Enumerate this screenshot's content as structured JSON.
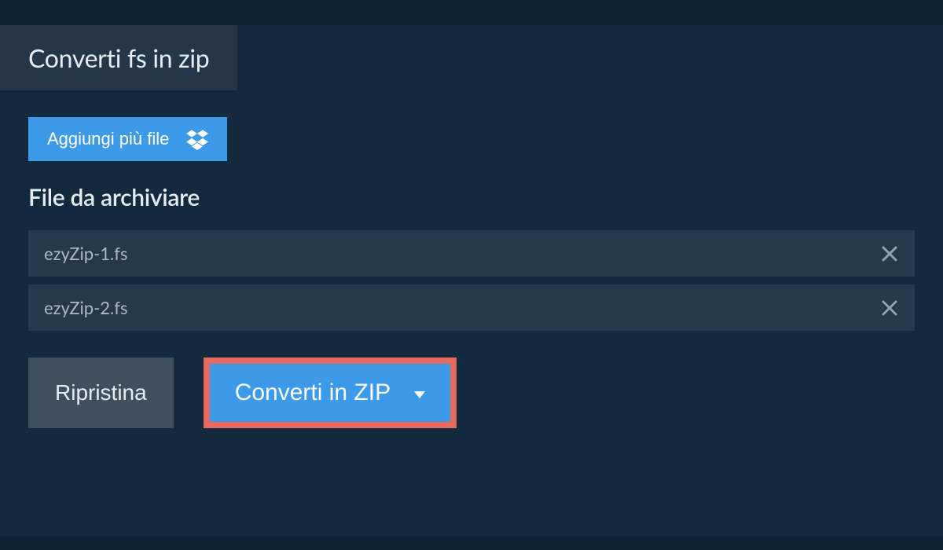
{
  "tab": {
    "title": "Converti fs in zip"
  },
  "add_files": {
    "label": "Aggiungi più file"
  },
  "section": {
    "heading": "File da archiviare"
  },
  "files": [
    {
      "name": "ezyZip-1.fs"
    },
    {
      "name": "ezyZip-2.fs"
    }
  ],
  "actions": {
    "reset": "Ripristina",
    "convert": "Converti in ZIP"
  },
  "colors": {
    "accent": "#3d9ae8",
    "highlight_border": "#e86a5e",
    "panel_bg": "#12293e",
    "tab_bg": "#233749"
  }
}
